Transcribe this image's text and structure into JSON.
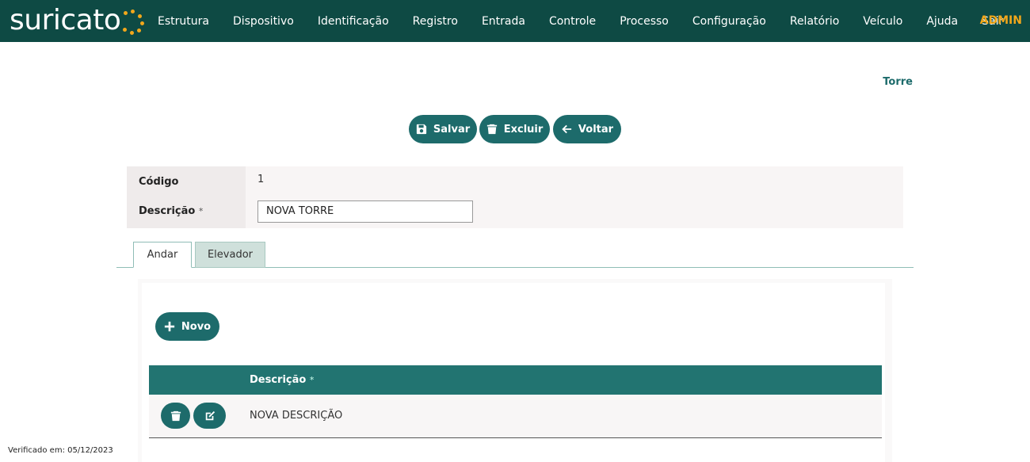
{
  "app": {
    "logo_text": "suricato",
    "nav": [
      "Estrutura",
      "Dispositivo",
      "Identificação",
      "Registro",
      "Entrada",
      "Controle",
      "Processo",
      "Configuração",
      "Relatório",
      "Veículo",
      "Ajuda",
      "Sair"
    ],
    "user": "ADMIN",
    "colors": {
      "header": "#0e4a44",
      "accent": "#1d6b6b",
      "brand_orange": "#f2a71b"
    }
  },
  "page": {
    "heading": "Torre"
  },
  "toolbar": {
    "save_label": "Salvar",
    "delete_label": "Excluir",
    "back_label": "Voltar"
  },
  "form": {
    "codigo_label": "Código",
    "codigo_value": "1",
    "descricao_label": "Descrição",
    "required_mark": "*",
    "descricao_value": "NOVA TORRE"
  },
  "tabs": [
    {
      "label": "Andar",
      "active": true
    },
    {
      "label": "Elevador",
      "active": false
    }
  ],
  "andar": {
    "new_label": "Novo",
    "column_header": "Descrição",
    "required_mark": "*",
    "rows": [
      {
        "descricao": "NOVA DESCRIÇÃO"
      }
    ]
  },
  "footer": {
    "verified_text": "Verificado em: 05/12/2023"
  }
}
